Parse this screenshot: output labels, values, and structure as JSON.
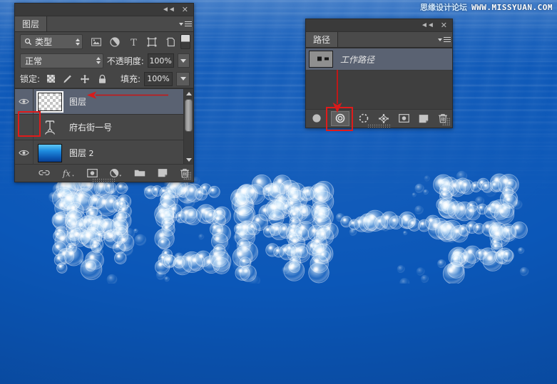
{
  "app": {
    "name": "Adobe Photoshop",
    "theme_bg": "#454545",
    "accent_selected": "#5a6272",
    "annotation_color": "#e01b1b"
  },
  "watermark": {
    "chinese": "思缘设计论坛",
    "url": "WWW.MISSYUAN.COM"
  },
  "canvas": {
    "artwork_text": "府右街一号",
    "artwork_style": "bubble-chain luminous text on underwater blue gradient",
    "background_description": "underwater ocean gradient, light blue surface at top to deep blue at bottom"
  },
  "layers_panel": {
    "tab_label": "图层",
    "titlebar": {
      "collapse_icon": "collapse-double-chevron-icon",
      "close_icon": "close-icon"
    },
    "menu_icon": "panel-menu-icon",
    "filter": {
      "search_icon": "search-icon",
      "kind_label": "类型",
      "icons": [
        {
          "name": "filter-pixel-icon",
          "glyph": "image"
        },
        {
          "name": "filter-adjustment-icon",
          "glyph": "circle-half"
        },
        {
          "name": "filter-type-icon",
          "glyph": "T"
        },
        {
          "name": "filter-shape-icon",
          "glyph": "shape"
        },
        {
          "name": "filter-smart-object-icon",
          "glyph": "smart-object"
        }
      ],
      "toggle_name": "filter-enable-toggle"
    },
    "blend": {
      "mode_label": "正常",
      "opacity_label": "不透明度:",
      "opacity_value": "100%"
    },
    "lock": {
      "label": "锁定:",
      "icons": [
        {
          "name": "lock-transparent-pixels-icon"
        },
        {
          "name": "lock-image-pixels-icon"
        },
        {
          "name": "lock-position-icon"
        },
        {
          "name": "lock-all-icon"
        }
      ],
      "fill_label": "填充:",
      "fill_value": "100%"
    },
    "layers": [
      {
        "name": "图层",
        "suffix": "",
        "visible": true,
        "selected": true,
        "thumb_type": "transparent",
        "has_highlight_outline": true
      },
      {
        "name": "府右街一号",
        "suffix": "",
        "visible": false,
        "selected": false,
        "thumb_type": "type",
        "has_highlight_outline": false
      },
      {
        "name": "图层",
        "suffix": " 2",
        "visible": true,
        "selected": false,
        "thumb_type": "water",
        "has_highlight_outline": false
      }
    ],
    "scrollbar": {
      "up_name": "scroll-up-arrow",
      "down_name": "scroll-down-arrow",
      "thumb_name": "scrollbar-thumb"
    },
    "footer_buttons": [
      {
        "name": "link-layers-button",
        "glyph": "link"
      },
      {
        "name": "layer-style-button",
        "glyph": "fx"
      },
      {
        "name": "add-layer-mask-button",
        "glyph": "mask"
      },
      {
        "name": "new-adjustment-layer-button",
        "glyph": "adjustment"
      },
      {
        "name": "new-group-button",
        "glyph": "folder"
      },
      {
        "name": "new-layer-button",
        "glyph": "new-page"
      },
      {
        "name": "delete-layer-button",
        "glyph": "trash"
      }
    ]
  },
  "paths_panel": {
    "tab_label": "路径",
    "titlebar": {
      "collapse_icon": "collapse-double-chevron-icon",
      "close_icon": "close-icon"
    },
    "menu_icon": "panel-menu-icon",
    "paths": [
      {
        "name": "工作路径",
        "selected": true
      }
    ],
    "footer_buttons": [
      {
        "name": "fill-path-button",
        "glyph": "filled-circle",
        "highlighted": false
      },
      {
        "name": "stroke-path-button",
        "glyph": "ring",
        "highlighted": true
      },
      {
        "name": "load-path-as-selection-button",
        "glyph": "dashed-circle",
        "highlighted": false
      },
      {
        "name": "make-work-path-button",
        "glyph": "anchor-points",
        "highlighted": false
      },
      {
        "name": "add-vector-mask-button",
        "glyph": "mask",
        "highlighted": false
      },
      {
        "name": "new-path-button",
        "glyph": "new-page",
        "highlighted": false
      },
      {
        "name": "delete-path-button",
        "glyph": "trash",
        "highlighted": false
      }
    ]
  },
  "annotations": [
    {
      "name": "annotation-box-visibility-toggle",
      "type": "rectangle",
      "target": "hidden layer eye toggle"
    },
    {
      "name": "annotation-arrow-to-layer",
      "type": "arrow-left",
      "target": "图层 layer row"
    },
    {
      "name": "annotation-box-stroke-path",
      "type": "rectangle",
      "target": "stroke path button"
    },
    {
      "name": "annotation-arrow-to-stroke-path",
      "type": "arrow-down",
      "target": "stroke path button"
    }
  ]
}
